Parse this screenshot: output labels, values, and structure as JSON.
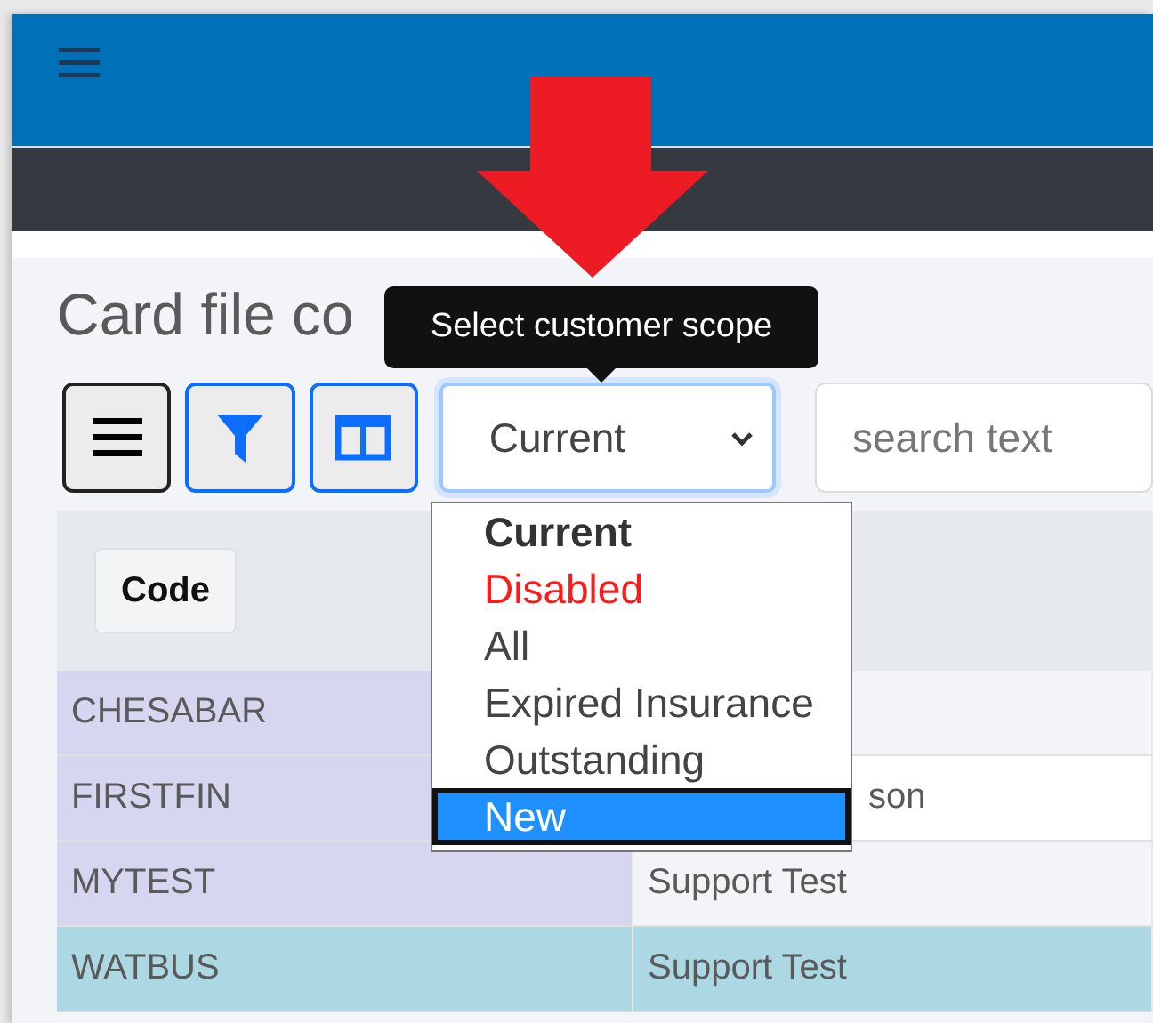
{
  "page": {
    "title": "Card file co"
  },
  "tooltip": {
    "text": "Select customer scope"
  },
  "toolbar": {
    "scope": {
      "value": "Current",
      "open": true
    },
    "search": {
      "placeholder": "search text"
    }
  },
  "scope_options": [
    {
      "label": "Current",
      "kind": "current",
      "selected": false
    },
    {
      "label": "Disabled",
      "kind": "disabled",
      "selected": false
    },
    {
      "label": "All",
      "kind": "plain",
      "selected": false
    },
    {
      "label": "Expired Insurance",
      "kind": "plain",
      "selected": false
    },
    {
      "label": "Outstanding",
      "kind": "plain",
      "selected": false
    },
    {
      "label": "New",
      "kind": "plain",
      "selected": true
    }
  ],
  "table": {
    "columns": [
      "Code"
    ],
    "rows": [
      {
        "code": "CHESABAR",
        "name": "",
        "selected": false
      },
      {
        "code": "FIRSTFIN",
        "name": "son",
        "selected": false
      },
      {
        "code": "MYTEST",
        "name": "Support Test",
        "selected": false
      },
      {
        "code": "WATBUS",
        "name": "Support Test",
        "selected": true
      }
    ]
  }
}
